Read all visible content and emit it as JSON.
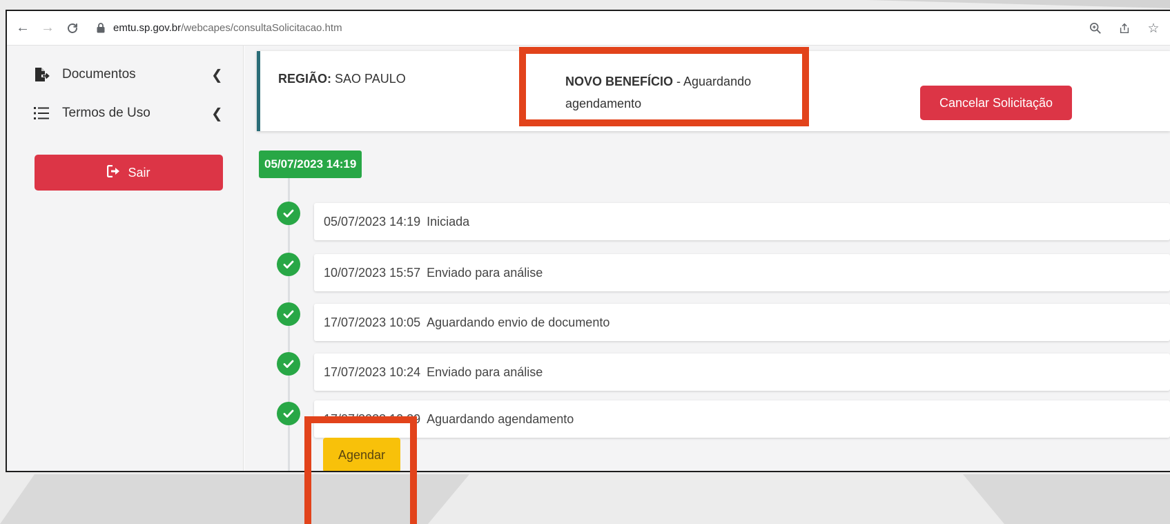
{
  "browser": {
    "url_host": "emtu.sp.gov.br",
    "url_path": "/webcapes/consultaSolicitacao.htm"
  },
  "sidebar": {
    "items": [
      {
        "label": "Documentos",
        "icon": "file-export-icon"
      },
      {
        "label": "Termos de Uso",
        "icon": "list-icon"
      }
    ],
    "logout_label": "Sair"
  },
  "status": {
    "region_label": "REGIÃO:",
    "region_value": "SAO PAULO",
    "benefit_label": "NOVO BENEFÍCIO",
    "benefit_status": " - Aguardando agendamento",
    "cancel_label": "Cancelar Solicitação"
  },
  "timeline": {
    "group_date": "05/07/2023 14:19",
    "events": [
      {
        "date": "05/07/2023 14:19",
        "text": "Iniciada"
      },
      {
        "date": "10/07/2023 15:57",
        "text": "Enviado para análise"
      },
      {
        "date": "17/07/2023 10:05",
        "text": "Aguardando envio de documento"
      },
      {
        "date": "17/07/2023 10:24",
        "text": "Enviado para análise"
      },
      {
        "date": "17/07/2023 10:29",
        "text": "Aguardando agendamento"
      }
    ],
    "schedule_label": "Agendar"
  },
  "colors": {
    "danger": "#dc3546",
    "success": "#28a746",
    "warning": "#f8c10a",
    "card_accent": "#2b6d78",
    "highlight": "#e2431b"
  }
}
